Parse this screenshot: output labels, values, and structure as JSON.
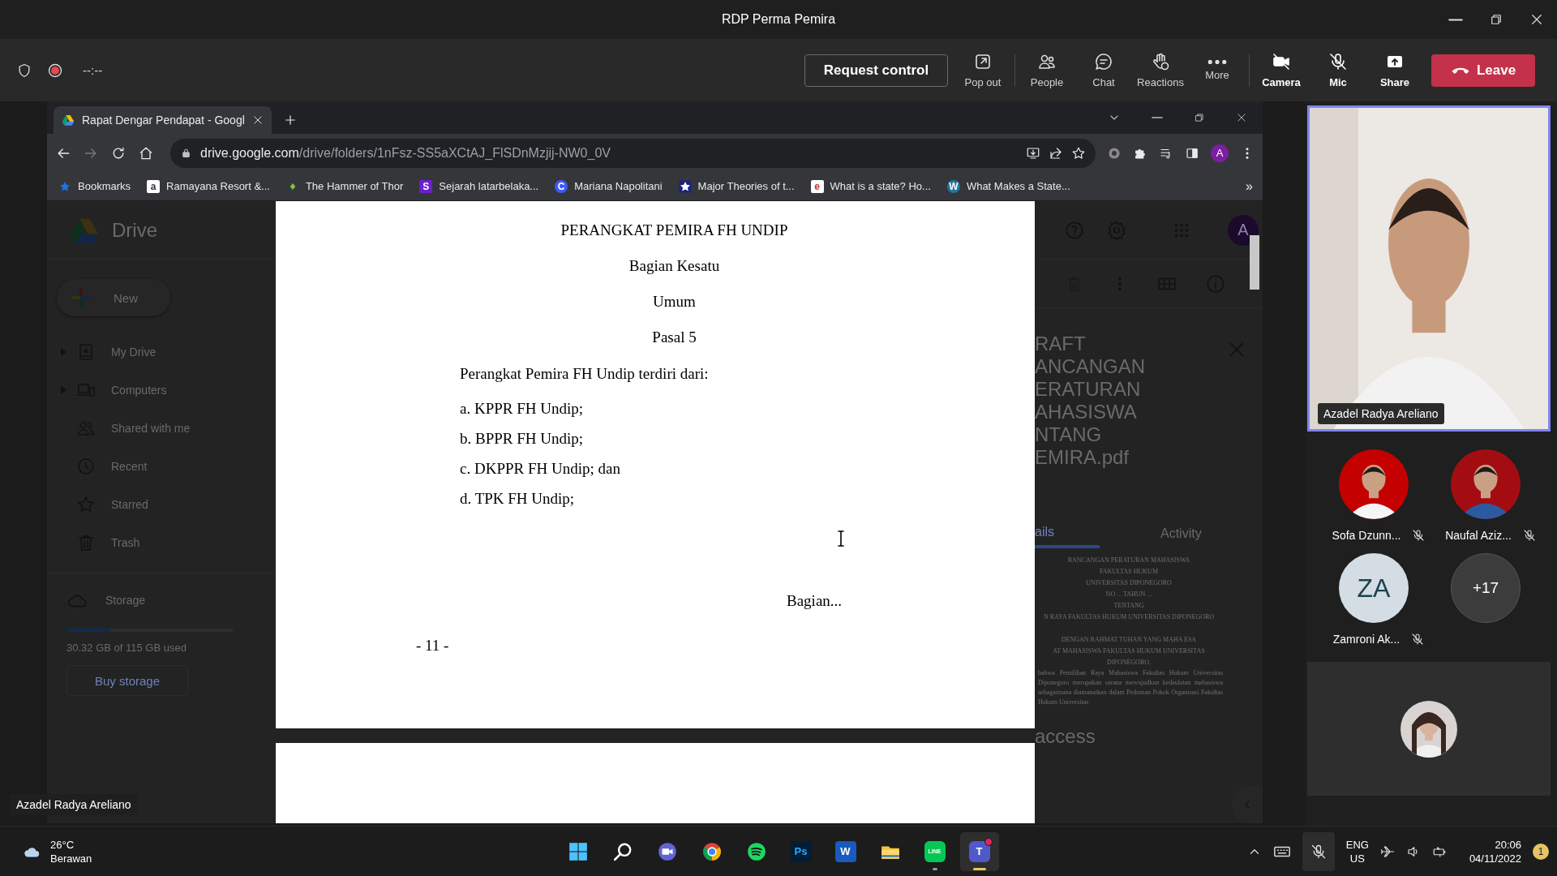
{
  "window": {
    "title": "RDP Perma Pemira"
  },
  "meeting_bar": {
    "timer": "--:--",
    "request_control": "Request control",
    "actions": [
      {
        "kind": "popout",
        "label": "Pop out"
      },
      {
        "kind": "people",
        "label": "People"
      },
      {
        "kind": "chat",
        "label": "Chat"
      },
      {
        "kind": "reactions",
        "label": "Reactions"
      },
      {
        "kind": "more",
        "label": "More"
      }
    ],
    "devices": [
      {
        "kind": "camera",
        "label": "Camera",
        "on": false
      },
      {
        "kind": "mic",
        "label": "Mic",
        "on": false
      }
    ],
    "share": "Share",
    "leave": "Leave"
  },
  "browser": {
    "tab": {
      "title": "Rapat Dengar Pendapat - Googl"
    },
    "url": {
      "host": "drive.google.com",
      "path": "/drive/folders/1nFsz-SS5aXCtAJ_FlSDnMzjij-NW0_0V"
    },
    "profile": "A",
    "bookmarks": [
      {
        "kind": "folder",
        "label": "Bookmarks",
        "color": "#1a73e8"
      },
      {
        "kind": "letter",
        "icon_text": "a",
        "label": "Ramayana Resort &...",
        "color": "#ffffff"
      },
      {
        "kind": "leaf",
        "label": "The Hammer of Thor",
        "color": "#7cc242"
      },
      {
        "kind": "letter",
        "icon_text": "S",
        "label": "Sejarah latarbelaka...",
        "color": "#6a1fd1"
      },
      {
        "kind": "round",
        "icon_text": "C",
        "label": "Mariana Napolitani",
        "color": "#3d5afe"
      },
      {
        "kind": "star",
        "label": "Major Theories of t...",
        "color": "#1a237e"
      },
      {
        "kind": "letter",
        "icon_text": "e",
        "label": "What is a state? Ho...",
        "color": "#ffffff"
      },
      {
        "kind": "round",
        "icon_text": "W",
        "label": "What Makes a State...",
        "color": "#21759b"
      }
    ],
    "overflow": "»"
  },
  "drive": {
    "logo": "Drive",
    "new": "New",
    "nav": [
      {
        "kind": "my-drive",
        "label": "My Drive",
        "collapsible": true
      },
      {
        "kind": "computers",
        "label": "Computers",
        "collapsible": true
      },
      {
        "kind": "shared",
        "label": "Shared with me",
        "collapsible": false
      },
      {
        "kind": "recent",
        "label": "Recent",
        "collapsible": false
      },
      {
        "kind": "starred",
        "label": "Starred",
        "collapsible": false
      },
      {
        "kind": "trash",
        "label": "Trash",
        "collapsible": false
      }
    ],
    "storage": {
      "label": "Storage",
      "level": 0.26,
      "usage": "30.32 GB of 115 GB used",
      "buy": "Buy storage"
    },
    "account": "A",
    "details": {
      "title_lines": [
        "RAFT",
        "ANCANGAN",
        "ERATURAN",
        "AHASISWA",
        "NTANG",
        "EMIRA.pdf"
      ],
      "tabs": [
        {
          "label": "ails",
          "selected": true
        },
        {
          "label": "Activity",
          "selected": false
        }
      ],
      "thumbnail_title_lines": [
        "RANCANGAN PERATURAN MAHASISWA",
        "FAKULTAS HUKUM",
        "UNIVERSITAS DIPONEGORO",
        "NO ... TAHUN ...",
        "TENTANG",
        "N RAYA FAKULTAS HUKUM UNIVERSITAS DIPONEGORO"
      ],
      "thumbnail_preamble_lines": [
        "DENGAN RAHMAT TUHAN YANG MAHA ESA",
        "AT MAHASISWA FAKULTAS HUKUM UNIVERSITAS",
        "DIPONEGORO,"
      ],
      "thumbnail_paragraph": "bahwa Pemilihan Raya Mahasiswa Fakultas Hukum Universitas Diponegoro merupakan sarana mewujudkan kedaulatan mahasiswa sebagaimana diamanatkan dalam Pedoman Pokok Organisasi Fakultas Hukum Universitas",
      "section": "access"
    }
  },
  "document": {
    "headings": [
      "PERANGKAT PEMIRA FH UNDIP",
      "Bagian Kesatu",
      "Umum",
      "Pasal 5"
    ],
    "intro": "Perangkat Pemira FH Undip terdiri dari:",
    "items": [
      "a. KPPR FH Undip;",
      "b. BPPR FH Undip;",
      "c. DKPPR FH Undip; dan",
      "d. TPK FH Undip;"
    ],
    "catchword": "Bagian...",
    "page_number": "- 11 -"
  },
  "presenter_label": "Azadel Radya Areliano",
  "participants": {
    "speaker": {
      "name": "Azadel Radya Areliano"
    },
    "tiles": [
      {
        "name": "Sofa Dzunn...",
        "muted": true,
        "color": "#c40000"
      },
      {
        "name": "Naufal Aziz...",
        "muted": true,
        "color": "#a30d12"
      },
      {
        "kind": "initials",
        "initials": "ZA",
        "name": "Zamroni Ak...",
        "muted": true
      },
      {
        "kind": "overflow",
        "count": "+17"
      }
    ]
  },
  "taskbar": {
    "weather": {
      "temperature": "26°C",
      "condition": "Berawan"
    },
    "apps": [
      {
        "kind": "start",
        "running": false,
        "active": false,
        "alert": false
      },
      {
        "kind": "search",
        "running": false,
        "active": false,
        "alert": false
      },
      {
        "kind": "meet",
        "running": false,
        "active": false,
        "alert": false
      },
      {
        "kind": "chrome",
        "running": false,
        "active": false,
        "alert": false
      },
      {
        "kind": "spotify",
        "running": false,
        "active": false,
        "alert": false
      },
      {
        "kind": "photoshop",
        "icon_text": "Ps",
        "running": false,
        "active": false,
        "alert": false
      },
      {
        "kind": "word",
        "icon_text": "W",
        "running": false,
        "active": false,
        "alert": false
      },
      {
        "kind": "explorer",
        "running": false,
        "active": false,
        "alert": false
      },
      {
        "kind": "line",
        "icon_text": "LINE",
        "running": true,
        "active": false,
        "alert": false
      },
      {
        "kind": "teams",
        "icon_text": "T",
        "running": true,
        "active": true,
        "alert": true
      }
    ],
    "language": "ENG",
    "region": "US",
    "time": "20:06",
    "date": "04/11/2022",
    "notification_count": "1"
  }
}
